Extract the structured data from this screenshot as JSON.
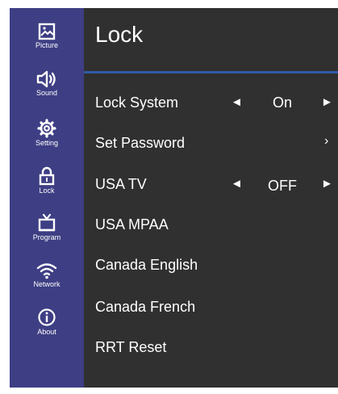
{
  "sidebar": {
    "items": [
      {
        "label": "Picture",
        "icon": "picture-icon"
      },
      {
        "label": "Sound",
        "icon": "speaker-icon"
      },
      {
        "label": "Setting",
        "icon": "gear-icon"
      },
      {
        "label": "Lock",
        "icon": "lock-icon"
      },
      {
        "label": "Program",
        "icon": "tv-icon"
      },
      {
        "label": "Network",
        "icon": "wifi-icon"
      },
      {
        "label": "About",
        "icon": "info-icon"
      }
    ]
  },
  "main": {
    "title": "Lock",
    "rows": [
      {
        "label": "Lock System",
        "value": "On",
        "control": "arrows"
      },
      {
        "label": "Set Password",
        "control": "chevron"
      },
      {
        "label": "USA TV",
        "value": "OFF",
        "control": "arrows"
      },
      {
        "label": "USA MPAA",
        "control": "none"
      },
      {
        "label": "Canada English",
        "control": "none"
      },
      {
        "label": "Canada French",
        "control": "none"
      },
      {
        "label": "RRT Reset",
        "control": "none"
      }
    ]
  },
  "glyphs": {
    "left_arrow": "◄",
    "right_arrow": "►",
    "chevron": "›"
  },
  "colors": {
    "sidebar": "#3e3e84",
    "background": "#303030",
    "divider": "#2f5aa8",
    "text": "#ffffff"
  }
}
